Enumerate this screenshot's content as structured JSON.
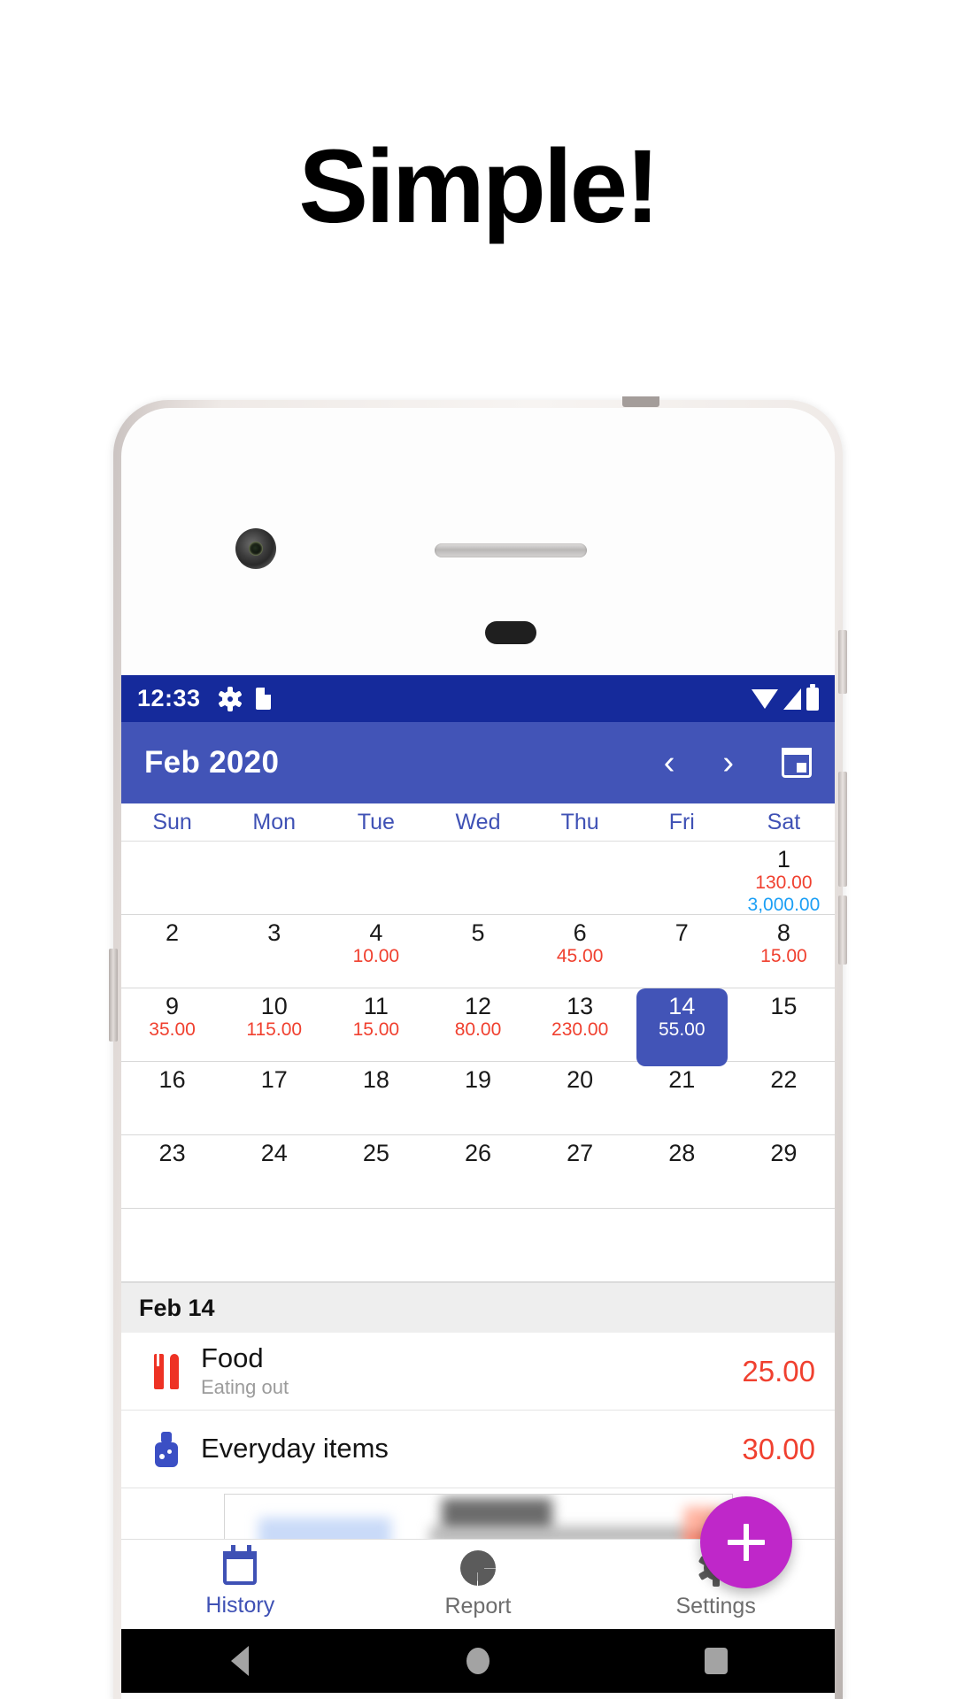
{
  "headline": "Simple!",
  "status_bar": {
    "time": "12:33",
    "icons": [
      "gear-icon",
      "sd-card-icon",
      "wifi-icon",
      "signal-icon",
      "battery-icon"
    ]
  },
  "app_bar": {
    "title": "Feb 2020",
    "prev_label": "‹",
    "next_label": "›",
    "calendar_icon": "calendar-icon"
  },
  "calendar": {
    "weekdays": [
      "Sun",
      "Mon",
      "Tue",
      "Wed",
      "Thu",
      "Fri",
      "Sat"
    ],
    "selected_day": 14,
    "expense_color": "#f0402f",
    "income_color": "#1b9ff5",
    "selected_color": "#4254b7",
    "rows": [
      [
        {
          "day": ""
        },
        {
          "day": ""
        },
        {
          "day": ""
        },
        {
          "day": ""
        },
        {
          "day": ""
        },
        {
          "day": ""
        },
        {
          "day": "1",
          "expense": "130.00",
          "income": "3,000.00"
        }
      ],
      [
        {
          "day": "2"
        },
        {
          "day": "3"
        },
        {
          "day": "4",
          "expense": "10.00"
        },
        {
          "day": "5"
        },
        {
          "day": "6",
          "expense": "45.00"
        },
        {
          "day": "7"
        },
        {
          "day": "8",
          "expense": "15.00"
        }
      ],
      [
        {
          "day": "9",
          "expense": "35.00"
        },
        {
          "day": "10",
          "expense": "115.00"
        },
        {
          "day": "11",
          "expense": "15.00"
        },
        {
          "day": "12",
          "expense": "80.00"
        },
        {
          "day": "13",
          "expense": "230.00"
        },
        {
          "day": "14",
          "expense": "55.00",
          "selected": true
        },
        {
          "day": "15"
        }
      ],
      [
        {
          "day": "16"
        },
        {
          "day": "17"
        },
        {
          "day": "18"
        },
        {
          "day": "19"
        },
        {
          "day": "20"
        },
        {
          "day": "21"
        },
        {
          "day": "22"
        }
      ],
      [
        {
          "day": "23"
        },
        {
          "day": "24"
        },
        {
          "day": "25"
        },
        {
          "day": "26"
        },
        {
          "day": "27"
        },
        {
          "day": "28"
        },
        {
          "day": "29"
        }
      ],
      [
        {
          "day": ""
        },
        {
          "day": ""
        },
        {
          "day": ""
        },
        {
          "day": ""
        },
        {
          "day": ""
        },
        {
          "day": ""
        },
        {
          "day": ""
        }
      ]
    ]
  },
  "day_section": {
    "header": "Feb 14",
    "transactions": [
      {
        "icon": "food-icon",
        "title": "Food",
        "subtitle": "Eating out",
        "amount": "25.00"
      },
      {
        "icon": "bottle-icon",
        "title": "Everyday items",
        "subtitle": "",
        "amount": "30.00"
      }
    ]
  },
  "fab": {
    "label": "+",
    "color": "#bf27c9"
  },
  "bottom_nav": {
    "items": [
      {
        "label": "History",
        "icon": "calendar-icon",
        "active": true
      },
      {
        "label": "Report",
        "icon": "pie-chart-icon",
        "active": false
      },
      {
        "label": "Settings",
        "icon": "gear-icon",
        "active": false
      }
    ]
  },
  "android_nav": {
    "back": "back-icon",
    "home": "home-icon",
    "recents": "recents-icon"
  }
}
